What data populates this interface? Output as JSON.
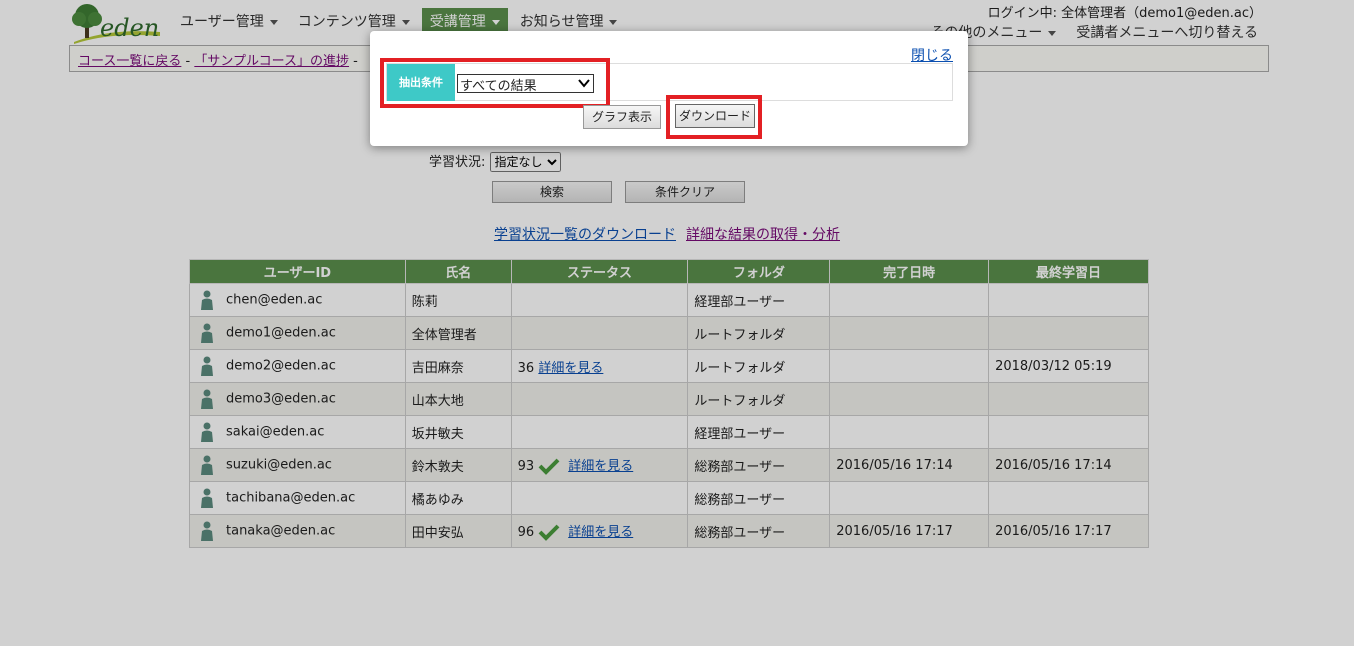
{
  "header": {
    "logo_text": "eden",
    "nav": [
      {
        "label": "ユーザー管理",
        "active": false
      },
      {
        "label": "コンテンツ管理",
        "active": false
      },
      {
        "label": "受講管理",
        "active": true
      },
      {
        "label": "お知らせ管理",
        "active": false
      }
    ],
    "login_info": "ログイン中: 全体管理者（demo1@eden.ac）",
    "other_menu": "その他のメニュー",
    "switch_menu": "受講者メニューへ切り替える"
  },
  "breadcrumb": {
    "back": "コース一覧に戻る",
    "sep1": " - ",
    "course": "「サンプルコース」の進捗",
    "sep2": " -"
  },
  "filter": {
    "status_label": "学習状況:",
    "status_value": "指定なし",
    "search_label": "検索",
    "clear_label": "条件クリア"
  },
  "links": {
    "download_list": "学習状況一覧のダウンロード",
    "detail_analysis": "詳細な結果の取得・分析"
  },
  "table": {
    "headers": [
      "ユーザーID",
      "氏名",
      "ステータス",
      "フォルダ",
      "完了日時",
      "最終学習日"
    ],
    "rows": [
      {
        "id": "chen@eden.ac",
        "name": "陈莉",
        "score": "",
        "done": false,
        "link": "",
        "folder": "経理部ユーザー",
        "completed": "",
        "last": ""
      },
      {
        "id": "demo1@eden.ac",
        "name": "全体管理者",
        "score": "",
        "done": false,
        "link": "",
        "folder": "ルートフォルダ",
        "completed": "",
        "last": ""
      },
      {
        "id": "demo2@eden.ac",
        "name": "吉田麻奈",
        "score": "36",
        "done": false,
        "link": "詳細を見る",
        "folder": "ルートフォルダ",
        "completed": "",
        "last": "2018/03/12 05:19"
      },
      {
        "id": "demo3@eden.ac",
        "name": "山本大地",
        "score": "",
        "done": false,
        "link": "",
        "folder": "ルートフォルダ",
        "completed": "",
        "last": ""
      },
      {
        "id": "sakai@eden.ac",
        "name": "坂井敏夫",
        "score": "",
        "done": false,
        "link": "",
        "folder": "経理部ユーザー",
        "completed": "",
        "last": ""
      },
      {
        "id": "suzuki@eden.ac",
        "name": "鈴木敦夫",
        "score": "93",
        "done": true,
        "link": "詳細を見る",
        "folder": "総務部ユーザー",
        "completed": "2016/05/16 17:14",
        "last": "2016/05/16 17:14"
      },
      {
        "id": "tachibana@eden.ac",
        "name": "橘あゆみ",
        "score": "",
        "done": false,
        "link": "",
        "folder": "総務部ユーザー",
        "completed": "",
        "last": ""
      },
      {
        "id": "tanaka@eden.ac",
        "name": "田中安弘",
        "score": "96",
        "done": true,
        "link": "詳細を見る",
        "folder": "総務部ユーザー",
        "completed": "2016/05/16 17:17",
        "last": "2016/05/16 17:17"
      }
    ]
  },
  "modal": {
    "close_label": "閉じる",
    "cond_label": "抽出条件",
    "cond_value": "すべての結果",
    "graph_label": "グラフ表示",
    "download_label": "ダウンロード"
  },
  "colors": {
    "nav_active": "#5b8f4c",
    "table_header": "#5b8f4c",
    "cond_label_bg": "#3ec9c7",
    "highlight_red": "#e32024"
  }
}
